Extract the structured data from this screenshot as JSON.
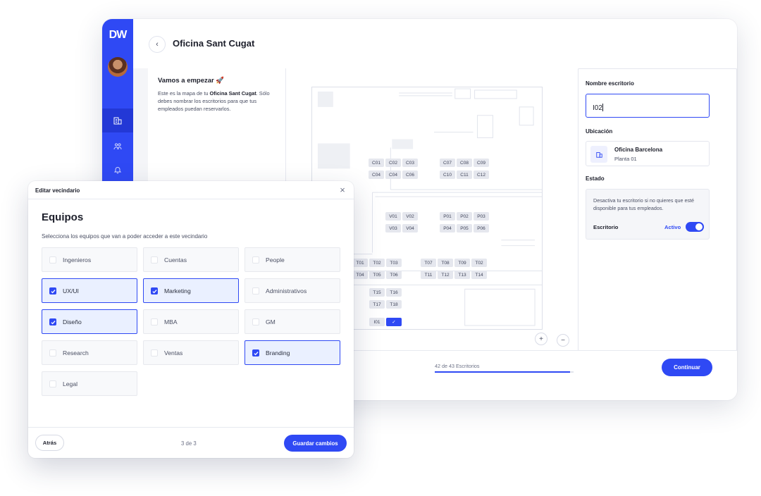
{
  "app": {
    "logo": "DW",
    "title": "Oficina Sant Cugat",
    "back_icon": "‹"
  },
  "sidebar": {
    "items": [
      {
        "name": "dashboard-icon"
      },
      {
        "name": "building-icon",
        "active": true
      },
      {
        "name": "team-icon"
      },
      {
        "name": "bell-icon"
      }
    ]
  },
  "intro": {
    "title": "Vamos a empezar 🚀",
    "text_before": "Este es la mapa de tu ",
    "office_bold": "Oficina Sant Cugat",
    "text_after": ". Sólo debes nombrar los escritorios para que tus empleados puedan reservarlos."
  },
  "map": {
    "desks": [
      "C01",
      "C02",
      "C03",
      "C04",
      "C04",
      "C06",
      "C07",
      "C08",
      "C09",
      "C10",
      "C11",
      "C12",
      "V01",
      "V02",
      "V03",
      "V04",
      "P01",
      "P02",
      "P03",
      "P04",
      "P05",
      "P06",
      "T01",
      "T02",
      "T03",
      "T04",
      "T05",
      "T06",
      "T07",
      "T08",
      "T09",
      "T02",
      "T11",
      "T12",
      "T13",
      "T14",
      "T15",
      "T16",
      "T17",
      "T18",
      "P01",
      "P02",
      "I01"
    ],
    "selected_icon": "✓",
    "zoom_in": "+",
    "zoom_out": "−"
  },
  "desk_panel": {
    "name_label": "Nombre escritorio",
    "name_value": "I02",
    "location_label": "Ubicación",
    "location_name": "Oficina Barcelona",
    "location_floor": "Planta 01",
    "state_label": "Estado",
    "state_description": "Desactiva tu escritorio si no quieres que esté disponible para tus empleados.",
    "desk_label": "Escritorio",
    "active_label": "Activo",
    "active": true
  },
  "footer": {
    "count_text": "42 de 43 Escritorios",
    "progress": 0.977,
    "continue_label": "Continuar"
  },
  "modal": {
    "header_title": "Editar vecindario",
    "close_icon": "×",
    "section_title": "Equipos",
    "description": "Selecciona los equipos que van a poder acceder a este vecindario",
    "teams": [
      {
        "label": "Ingenieros",
        "checked": false
      },
      {
        "label": "Cuentas",
        "checked": false
      },
      {
        "label": "People",
        "checked": false
      },
      {
        "label": "UX/UI",
        "checked": true
      },
      {
        "label": "Marketing",
        "checked": true
      },
      {
        "label": "Administrativos",
        "checked": false
      },
      {
        "label": "Diseño",
        "checked": true
      },
      {
        "label": "MBA",
        "checked": false
      },
      {
        "label": "GM",
        "checked": false
      },
      {
        "label": "Research",
        "checked": false
      },
      {
        "label": "Ventas",
        "checked": false
      },
      {
        "label": "Branding",
        "checked": true
      },
      {
        "label": "Legal",
        "checked": false
      }
    ],
    "back_label": "Atrás",
    "step_text": "3 de 3",
    "save_label": "Guardar cambios"
  },
  "colors": {
    "accent": "#2f49f4",
    "sidebar": "#2f49f4",
    "checked_bg": "#eaf0ff"
  }
}
